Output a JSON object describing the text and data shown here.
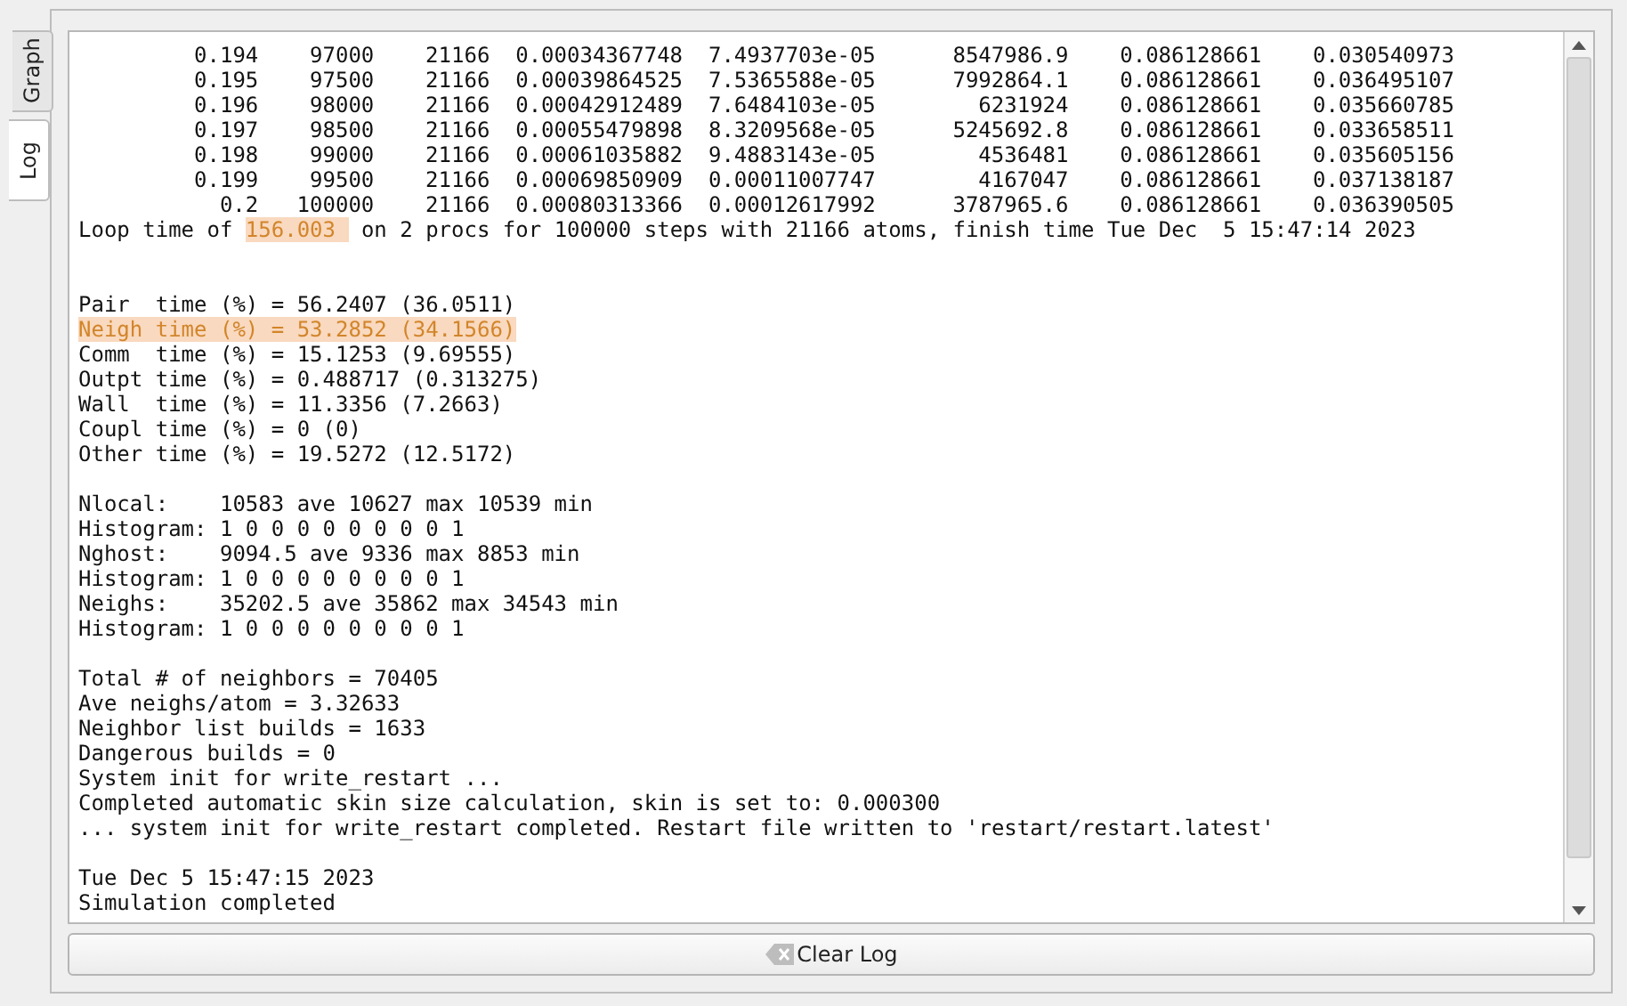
{
  "tabs": [
    {
      "label": "Graph",
      "selected": false
    },
    {
      "label": "Log",
      "selected": true
    }
  ],
  "log": {
    "rows": [
      [
        "0.194",
        "97000",
        "21166",
        "0.00034367748",
        "7.4937703e-05",
        "8547986.9",
        "0.086128661",
        "0.030540973"
      ],
      [
        "0.195",
        "97500",
        "21166",
        "0.00039864525",
        "7.5365588e-05",
        "7992864.1",
        "0.086128661",
        "0.036495107"
      ],
      [
        "0.196",
        "98000",
        "21166",
        "0.00042912489",
        "7.6484103e-05",
        "6231924",
        "0.086128661",
        "0.035660785"
      ],
      [
        "0.197",
        "98500",
        "21166",
        "0.00055479898",
        "8.3209568e-05",
        "5245692.8",
        "0.086128661",
        "0.033658511"
      ],
      [
        "0.198",
        "99000",
        "21166",
        "0.00061035882",
        "9.4883143e-05",
        "4536481",
        "0.086128661",
        "0.035605156"
      ],
      [
        "0.199",
        "99500",
        "21166",
        "0.00069850909",
        "0.00011007747",
        "4167047",
        "0.086128661",
        "0.037138187"
      ],
      [
        "0.2",
        "100000",
        "21166",
        "0.00080313366",
        "0.00012617992",
        "3787965.6",
        "0.086128661",
        "0.036390505"
      ]
    ],
    "loop_line": {
      "before": "Loop time of ",
      "highlight": "156.003",
      "after": " on 2 procs for 100000 steps with 21166 atoms, finish time Tue Dec  5 15:47:14 2023"
    },
    "sections": [
      [
        {
          "text": "Pair  time (%) = 56.2407 (36.0511)",
          "highlighted": false
        },
        {
          "text": "Neigh time (%) = 53.2852 (34.1566)",
          "highlighted": true
        },
        {
          "text": "Comm  time (%) = 15.1253 (9.69555)",
          "highlighted": false
        },
        {
          "text": "Outpt time (%) = 0.488717 (0.313275)",
          "highlighted": false
        },
        {
          "text": "Wall  time (%) = 11.3356 (7.2663)",
          "highlighted": false
        },
        {
          "text": "Coupl time (%) = 0 (0)",
          "highlighted": false
        },
        {
          "text": "Other time (%) = 19.5272 (12.5172)",
          "highlighted": false
        }
      ],
      [
        {
          "text": "Nlocal:    10583 ave 10627 max 10539 min",
          "highlighted": false
        },
        {
          "text": "Histogram: 1 0 0 0 0 0 0 0 0 1",
          "highlighted": false
        },
        {
          "text": "Nghost:    9094.5 ave 9336 max 8853 min",
          "highlighted": false
        },
        {
          "text": "Histogram: 1 0 0 0 0 0 0 0 0 1",
          "highlighted": false
        },
        {
          "text": "Neighs:    35202.5 ave 35862 max 34543 min",
          "highlighted": false
        },
        {
          "text": "Histogram: 1 0 0 0 0 0 0 0 0 1",
          "highlighted": false
        }
      ],
      [
        {
          "text": "Total # of neighbors = 70405",
          "highlighted": false
        },
        {
          "text": "Ave neighs/atom = 3.32633",
          "highlighted": false
        },
        {
          "text": "Neighbor list builds = 1633",
          "highlighted": false
        },
        {
          "text": "Dangerous builds = 0",
          "highlighted": false
        },
        {
          "text": "System init for write_restart ...",
          "highlighted": false
        },
        {
          "text": "Completed automatic skin size calculation, skin is set to: 0.000300",
          "highlighted": false
        },
        {
          "text": "... system init for write_restart completed. Restart file written to 'restart/restart.latest'",
          "highlighted": false
        }
      ],
      [
        {
          "text": "Tue Dec 5 15:47:15 2023",
          "highlighted": false
        },
        {
          "text": "Simulation completed",
          "highlighted": false
        }
      ]
    ]
  },
  "clear_button": {
    "label": "Clear Log"
  }
}
